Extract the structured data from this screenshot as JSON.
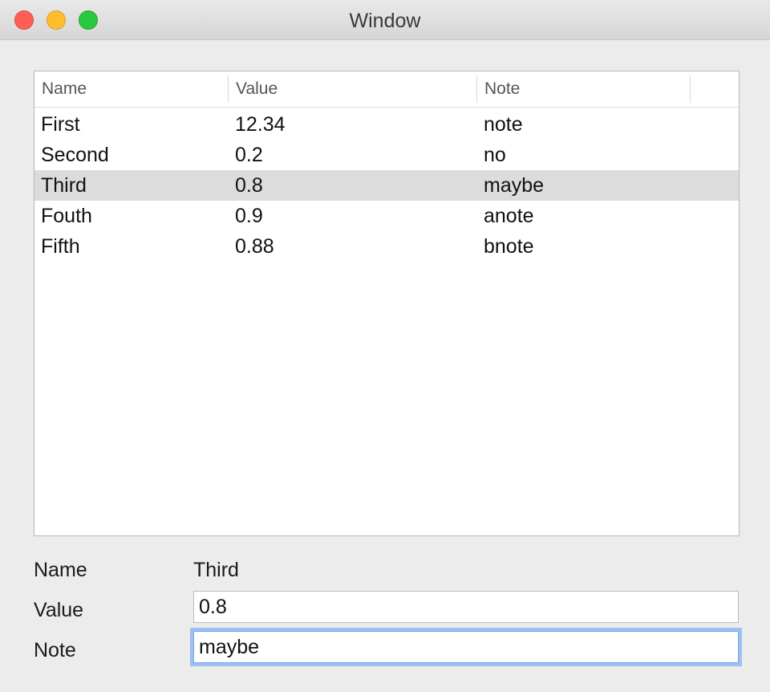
{
  "window": {
    "title": "Window"
  },
  "table": {
    "columns": [
      "Name",
      "Value",
      "Note"
    ],
    "rows": [
      {
        "name": "First",
        "value": "12.34",
        "note": "note",
        "selected": false
      },
      {
        "name": "Second",
        "value": "0.2",
        "note": "no",
        "selected": false
      },
      {
        "name": "Third",
        "value": "0.8",
        "note": "maybe",
        "selected": true
      },
      {
        "name": "Fouth",
        "value": "0.9",
        "note": "anote",
        "selected": false
      },
      {
        "name": "Fifth",
        "value": "0.88",
        "note": "bnote",
        "selected": false
      }
    ]
  },
  "form": {
    "name_label": "Name",
    "name_value": "Third",
    "value_label": "Value",
    "value_value": "0.8",
    "note_label": "Note",
    "note_value": "maybe"
  }
}
